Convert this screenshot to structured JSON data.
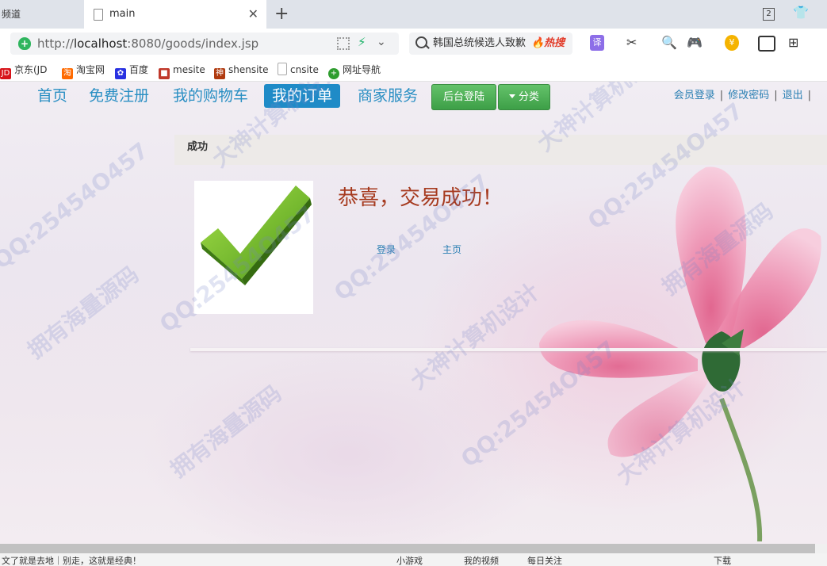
{
  "browser": {
    "prev_tab_label": "频道",
    "active_tab_title": "main",
    "tab_count": "2",
    "url_prefix": "http://",
    "url_host": "localhost",
    "url_rest": ":8080/goods/index.jsp",
    "search_text": "韩国总统候选人致歉",
    "hot_label": "🔥热搜",
    "translate_label": "译",
    "coin_label": "¥"
  },
  "bookmarks": [
    {
      "label": "京东(JD",
      "icon": "JD",
      "color": "#d7141a"
    },
    {
      "label": "淘宝网",
      "icon": "淘",
      "color": "#ff6a00"
    },
    {
      "label": "百度",
      "icon": "✿",
      "color": "#2932e1"
    },
    {
      "label": "mesite",
      "icon": "■",
      "color": "#c0392b"
    },
    {
      "label": "shensite",
      "icon": "神",
      "color": "#b03a0f"
    },
    {
      "label": "cnsite",
      "icon": "",
      "color": "#cccccc"
    },
    {
      "label": "网址导航",
      "icon": "+",
      "color": "#2f9d2f"
    }
  ],
  "nav": {
    "home": "首页",
    "register": "免费注册",
    "cart": "我的购物车",
    "orders": "我的订单",
    "merchant": "商家服务",
    "admin_login": "后台登陆",
    "category": "分类"
  },
  "top_links": {
    "member_login": "会员登录",
    "change_password": "修改密码",
    "logout": "退出",
    "separator": "|"
  },
  "panel": {
    "title": "成功",
    "message": "恭喜，交易成功！",
    "login_link": "登录",
    "home_link": "主页"
  },
  "watermarks": {
    "qq": "QQ:25454O457",
    "source": "拥有海量源码",
    "design": "大神计算机设计"
  },
  "status": {
    "left": "文了就是去地｜别走，这就是经典！",
    "game": "小游戏",
    "video": "我的视频",
    "news": "每日关注",
    "download": "下载"
  }
}
